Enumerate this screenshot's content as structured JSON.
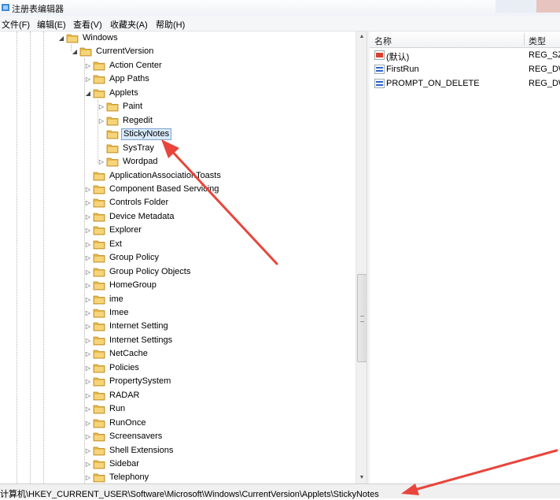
{
  "window": {
    "title": "注册表编辑器"
  },
  "menu": [
    "文件(F)",
    "编辑(E)",
    "查看(V)",
    "收藏夹(A)",
    "帮助(H)"
  ],
  "tree": [
    {
      "label": "Windows",
      "level": 0,
      "expanded": true
    },
    {
      "label": "CurrentVersion",
      "level": 1,
      "expanded": true
    },
    {
      "label": "Action Center",
      "level": 2,
      "expandable": true
    },
    {
      "label": "App Paths",
      "level": 2,
      "expandable": true
    },
    {
      "label": "Applets",
      "level": 2,
      "expanded": true
    },
    {
      "label": "Paint",
      "level": 3,
      "expandable": true
    },
    {
      "label": "Regedit",
      "level": 3,
      "expandable": true
    },
    {
      "label": "StickyNotes",
      "level": 3,
      "selected": true
    },
    {
      "label": "SysTray",
      "level": 3
    },
    {
      "label": "Wordpad",
      "level": 3,
      "expandable": true
    },
    {
      "label": "ApplicationAssociationToasts",
      "level": 2
    },
    {
      "label": "Component Based Servicing",
      "level": 2,
      "expandable": true
    },
    {
      "label": "Controls Folder",
      "level": 2,
      "expandable": true
    },
    {
      "label": "Device Metadata",
      "level": 2,
      "expandable": true
    },
    {
      "label": "Explorer",
      "level": 2,
      "expandable": true
    },
    {
      "label": "Ext",
      "level": 2,
      "expandable": true
    },
    {
      "label": "Group Policy",
      "level": 2,
      "expandable": true
    },
    {
      "label": "Group Policy Objects",
      "level": 2,
      "expandable": true
    },
    {
      "label": "HomeGroup",
      "level": 2,
      "expandable": true
    },
    {
      "label": "ime",
      "level": 2,
      "expandable": true
    },
    {
      "label": "Imee",
      "level": 2,
      "expandable": true
    },
    {
      "label": "Internet Setting",
      "level": 2,
      "expandable": true
    },
    {
      "label": "Internet Settings",
      "level": 2,
      "expandable": true
    },
    {
      "label": "NetCache",
      "level": 2,
      "expandable": true
    },
    {
      "label": "Policies",
      "level": 2,
      "expandable": true
    },
    {
      "label": "PropertySystem",
      "level": 2,
      "expandable": true
    },
    {
      "label": "RADAR",
      "level": 2,
      "expandable": true
    },
    {
      "label": "Run",
      "level": 2,
      "expandable": true
    },
    {
      "label": "RunOnce",
      "level": 2,
      "expandable": true
    },
    {
      "label": "Screensavers",
      "level": 2,
      "expandable": true
    },
    {
      "label": "Shell Extensions",
      "level": 2,
      "expandable": true
    },
    {
      "label": "Sidebar",
      "level": 2,
      "expandable": true
    },
    {
      "label": "Telephony",
      "level": 2,
      "expandable": true
    }
  ],
  "values_header": {
    "name": "名称",
    "type": "类型"
  },
  "values": [
    {
      "name": "(默认)",
      "type": "REG_SZ",
      "icon": "string-value-icon"
    },
    {
      "name": "FirstRun",
      "type": "REG_DW",
      "icon": "binary-value-icon"
    },
    {
      "name": "PROMPT_ON_DELETE",
      "type": "REG_DW",
      "icon": "binary-value-icon"
    }
  ],
  "status": {
    "path": "计算机\\HKEY_CURRENT_USER\\Software\\Microsoft\\Windows\\CurrentVersion\\Applets\\StickyNotes"
  },
  "colors": {
    "folder": "#e8b84a",
    "selection": "#d9eafc",
    "arrow": "#e8453c"
  }
}
